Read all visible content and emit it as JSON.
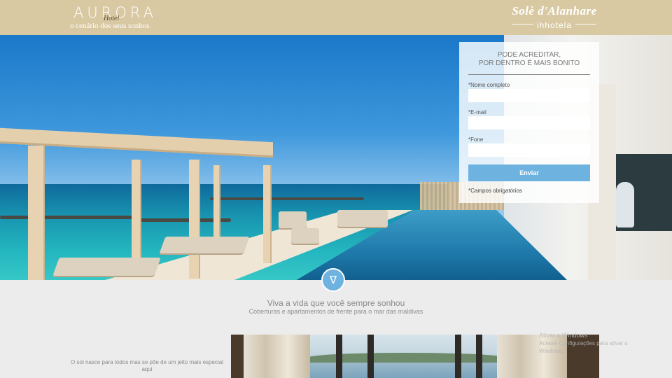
{
  "header": {
    "logo_left": {
      "brand": "AURORA",
      "sub": "Hotel",
      "tagline": "o cenário dos seus sonhos"
    },
    "logo_right": {
      "script": "Solè d'Alanhare",
      "brand": "ihhotela"
    }
  },
  "form": {
    "title_line1": "PODE ACREDITAR,",
    "title_line2": "POR DENTRO É MAIS BONITO",
    "fields": [
      {
        "label": "*Nome completo",
        "value": ""
      },
      {
        "label": "*E-mail",
        "value": ""
      },
      {
        "label": "*Fone",
        "value": ""
      }
    ],
    "submit_label": "Enviar",
    "required_note": "*Campos obrigatórios"
  },
  "scroll_button": {
    "icon": "down-triangle-icon",
    "glyph": "∇"
  },
  "section": {
    "headline": "Viva a vida que você sempre sonhou",
    "subline": "Coberturas e apartamentos de frente para o mar das maldivas",
    "side_text": "O sol nasce para todos mas se põe de um jeito mais especial aqui"
  },
  "watermark": {
    "title": "Ativar o Windows",
    "text": "Acesse Configurações para ativar o Windows."
  },
  "colors": {
    "header": "#d9c9a3",
    "accent": "#6eb3e0",
    "background": "#ececec"
  }
}
